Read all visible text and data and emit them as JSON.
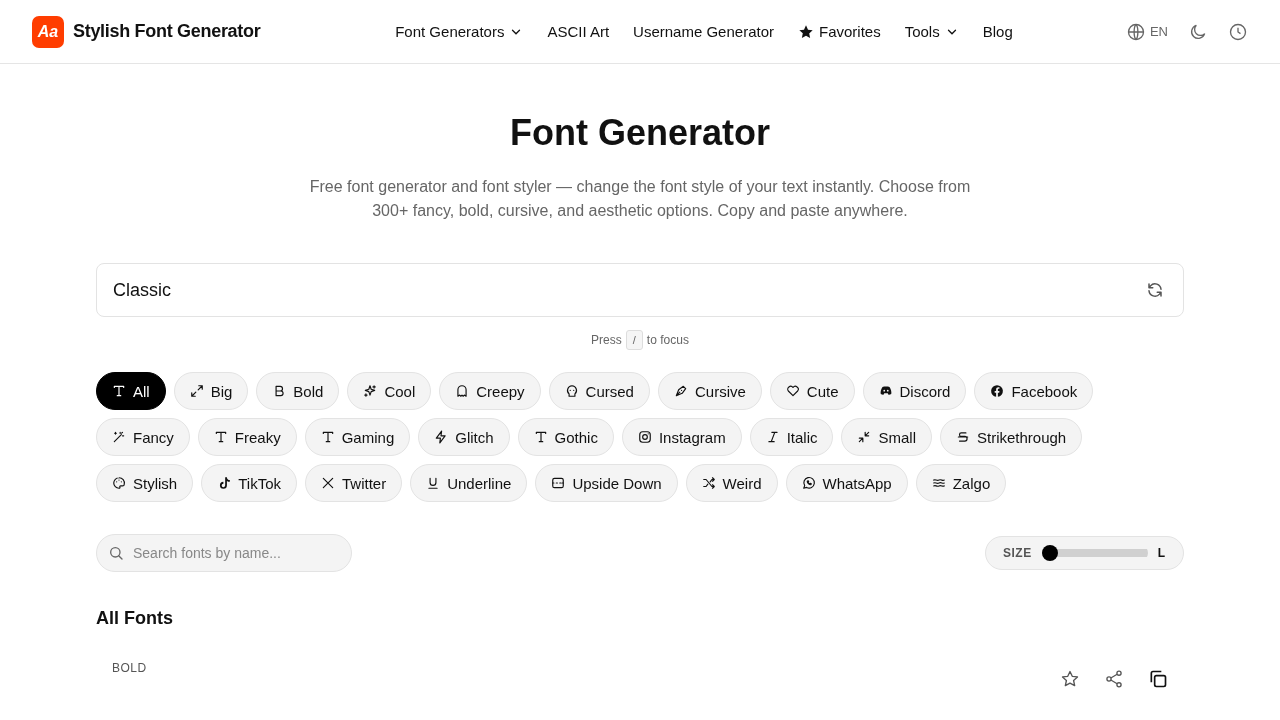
{
  "header": {
    "logo_mark": "Aa",
    "brand": "Stylish Font Generator",
    "nav": [
      {
        "label": "Font Generators",
        "kind": "dropdown"
      },
      {
        "label": "ASCII Art",
        "kind": "link"
      },
      {
        "label": "Username Generator",
        "kind": "link"
      },
      {
        "label": "Favorites",
        "kind": "starred"
      },
      {
        "label": "Tools",
        "kind": "dropdown"
      },
      {
        "label": "Blog",
        "kind": "link"
      }
    ],
    "language": "EN"
  },
  "hero": {
    "title": "Font Generator",
    "description": "Free font generator and font styler — change the font style of your text instantly. Choose from 300+ fancy, bold, cursive, and aesthetic options. Copy and paste anywhere."
  },
  "text_input": {
    "value": "Classic"
  },
  "hint": {
    "before": "Press",
    "key": "/",
    "after": "to focus"
  },
  "categories": [
    {
      "label": "All",
      "selected": true
    },
    {
      "label": "Big",
      "selected": false
    },
    {
      "label": "Bold",
      "selected": false
    },
    {
      "label": "Cool",
      "selected": false
    },
    {
      "label": "Creepy",
      "selected": false
    },
    {
      "label": "Cursed",
      "selected": false
    },
    {
      "label": "Cursive",
      "selected": false
    },
    {
      "label": "Cute",
      "selected": false
    },
    {
      "label": "Discord",
      "selected": false
    },
    {
      "label": "Facebook",
      "selected": false
    },
    {
      "label": "Fancy",
      "selected": false
    },
    {
      "label": "Freaky",
      "selected": false
    },
    {
      "label": "Gaming",
      "selected": false
    },
    {
      "label": "Glitch",
      "selected": false
    },
    {
      "label": "Gothic",
      "selected": false
    },
    {
      "label": "Instagram",
      "selected": false
    },
    {
      "label": "Italic",
      "selected": false
    },
    {
      "label": "Small",
      "selected": false
    },
    {
      "label": "Strikethrough",
      "selected": false
    },
    {
      "label": "Stylish",
      "selected": false
    },
    {
      "label": "TikTok",
      "selected": false
    },
    {
      "label": "Twitter",
      "selected": false
    },
    {
      "label": "Underline",
      "selected": false
    },
    {
      "label": "Upside Down",
      "selected": false
    },
    {
      "label": "Weird",
      "selected": false
    },
    {
      "label": "WhatsApp",
      "selected": false
    },
    {
      "label": "Zalgo",
      "selected": false
    }
  ],
  "font_search": {
    "placeholder": "Search fonts by name..."
  },
  "size": {
    "label": "SIZE",
    "end_label": "L",
    "level": 0
  },
  "section_title": "All Fonts",
  "font_card": {
    "label": "BOLD"
  }
}
